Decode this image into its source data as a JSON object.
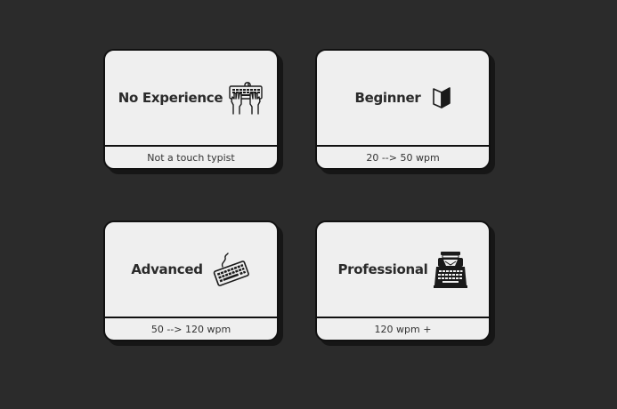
{
  "levels": [
    {
      "title": "No Experience",
      "subtitle": "Not a touch typist",
      "icon": "hands-on-keyboard-icon"
    },
    {
      "title": "Beginner",
      "subtitle": "20 --> 50 wpm",
      "icon": "open-book-icon"
    },
    {
      "title": "Advanced",
      "subtitle": "50 --> 120 wpm",
      "icon": "keyboard-icon"
    },
    {
      "title": "Professional",
      "subtitle": "120 wpm +",
      "icon": "typewriter-icon"
    }
  ],
  "colors": {
    "background": "#2b2b2b",
    "card": "#efefef",
    "border": "#111111",
    "text": "#2a2a2a"
  }
}
